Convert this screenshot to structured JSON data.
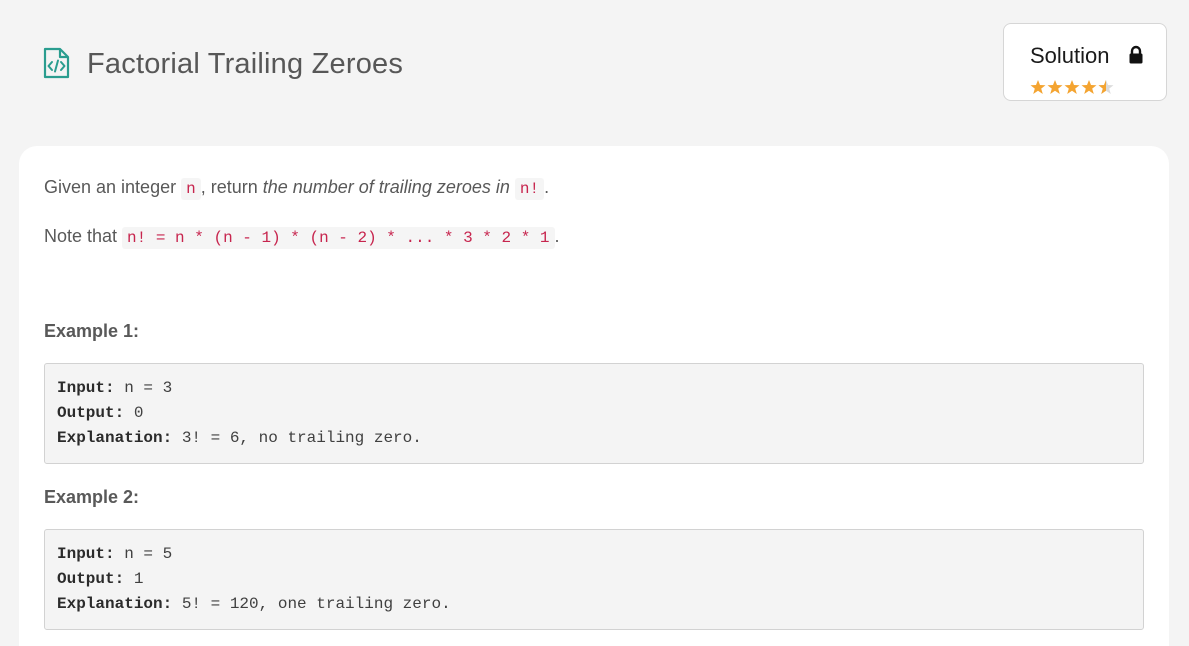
{
  "header": {
    "title": "Factorial Trailing Zeroes",
    "icon": "code-file-icon",
    "accent_color": "#2a9d8f"
  },
  "solution": {
    "label": "Solution",
    "locked": true,
    "rating_value": 4.5,
    "rating_max": 5,
    "star_color": "#f4a431"
  },
  "description": {
    "line1": {
      "before": "Given an integer ",
      "code1": "n",
      "middle": ", return ",
      "italic": "the number of trailing zeroes in ",
      "code2": "n!",
      "after": "."
    },
    "line2": {
      "before": "Note that ",
      "code": "n! = n * (n - 1) * (n - 2) * ... * 3 * 2 * 1",
      "after": "."
    }
  },
  "examples": [
    {
      "title": "Example 1:",
      "input_key": "Input:",
      "input": " n = 3",
      "output_key": "Output:",
      "output": " 0",
      "explanation_key": "Explanation:",
      "explanation": " 3! = 6, no trailing zero."
    },
    {
      "title": "Example 2:",
      "input_key": "Input:",
      "input": " n = 5",
      "output_key": "Output:",
      "output": " 1",
      "explanation_key": "Explanation:",
      "explanation": " 5! = 120, one trailing zero."
    }
  ]
}
